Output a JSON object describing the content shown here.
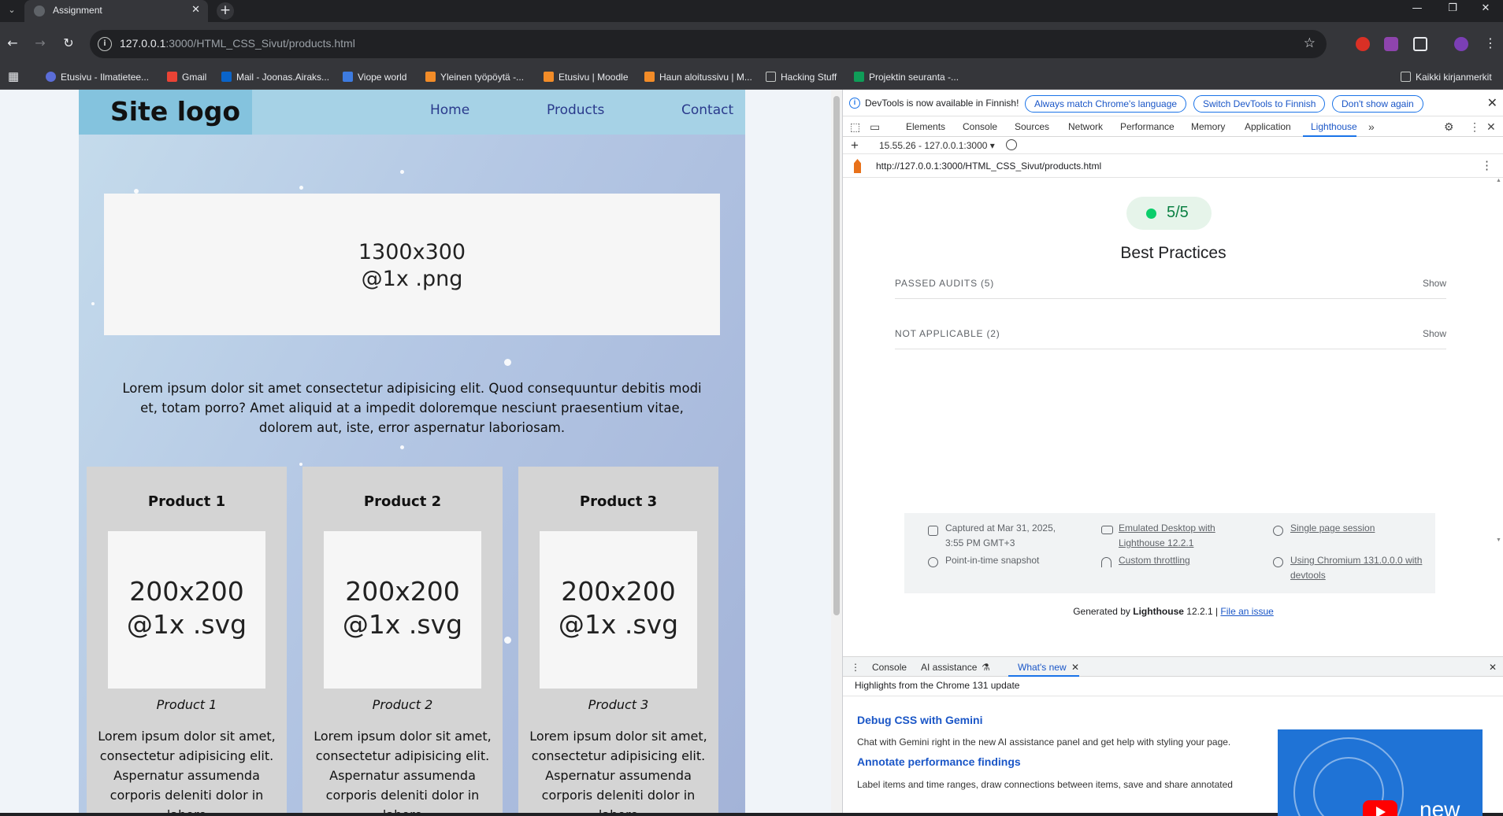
{
  "browser": {
    "tab_title": "Assignment",
    "tab_close": "✕",
    "new_tab": "+",
    "url_host": "127.0.0.1",
    "url_rest": ":3000/HTML_CSS_Sivut/products.html",
    "bookmarks": [
      "Etusivu - Ilmatietee...",
      "Gmail",
      "Mail - Joonas.Airaks...",
      "Viope world",
      "Yleinen työpöytä -...",
      "Etusivu | Moodle",
      "Haun aloitussivu | M...",
      "Hacking Stuff",
      "Projektin seuranta -..."
    ],
    "bookmarks_right": "Kaikki kirjanmerkit"
  },
  "site": {
    "logo": "Site logo",
    "nav": [
      "Home",
      "Products",
      "Contact"
    ],
    "hero_placeholder": "1300x300\n@1x .png",
    "intro": "Lorem ipsum dolor sit amet consectetur adipisicing elit. Quod consequuntur debitis modi et, totam porro? Amet aliquid at a impedit doloremque nesciunt praesentium vitae, dolorem aut, iste, error aspernatur laboriosam.",
    "products": [
      {
        "title": "Product 1",
        "image": "200x200\n@1x .svg",
        "caption": "Product 1",
        "desc": "Lorem ipsum dolor sit amet, consectetur adipisicing elit. Aspernatur assumenda corporis deleniti dolor in labore"
      },
      {
        "title": "Product 2",
        "image": "200x200\n@1x .svg",
        "caption": "Product 2",
        "desc": "Lorem ipsum dolor sit amet, consectetur adipisicing elit. Aspernatur assumenda corporis deleniti dolor in labore"
      },
      {
        "title": "Product 3",
        "image": "200x200\n@1x .svg",
        "caption": "Product 3",
        "desc": "Lorem ipsum dolor sit amet, consectetur adipisicing elit. Aspernatur assumenda corporis deleniti dolor in labore"
      }
    ]
  },
  "devtools": {
    "infobar": {
      "text": "DevTools is now available in Finnish!",
      "buttons": [
        "Always match Chrome's language",
        "Switch DevTools to Finnish",
        "Don't show again"
      ]
    },
    "tabs": [
      "Elements",
      "Console",
      "Sources",
      "Network",
      "Performance",
      "Memory",
      "Application",
      "Lighthouse"
    ],
    "active_tab": "Lighthouse",
    "report_select": "15.55.26 - 127.0.0.1:3000",
    "report_url": "http://127.0.0.1:3000/HTML_CSS_Sivut/products.html",
    "score": "5/5",
    "category": "Best Practices",
    "audits": [
      {
        "label": "PASSED AUDITS",
        "count": "(5)",
        "action": "Show"
      },
      {
        "label": "NOT APPLICABLE",
        "count": "(2)",
        "action": "Show"
      }
    ],
    "meta": {
      "captured": "Captured at Mar 31, 2025, 3:55 PM GMT+3",
      "snapshot": "Point-in-time snapshot",
      "emulated": "Emulated Desktop with Lighthouse 12.2.1",
      "throttling": "Custom throttling",
      "session": "Single page session",
      "chromium": "Using Chromium 131.0.0.0 with devtools"
    },
    "generated_prefix": "Generated by ",
    "generated_brand": "Lighthouse",
    "generated_version": " 12.2.1 | ",
    "file_issue": "File an issue",
    "drawer": {
      "tabs": [
        "Console",
        "AI assistance",
        "What's new"
      ],
      "active_tab": "What's new",
      "highlights": "Highlights from the Chrome 131 update",
      "items": [
        {
          "title": "Debug CSS with Gemini",
          "text": "Chat with Gemini right in the new AI assistance panel and get help with styling your page."
        },
        {
          "title": "Annotate performance findings",
          "text": "Label items and time ranges, draw connections between items, save and share annotated"
        }
      ],
      "video_text": "new"
    }
  },
  "colors": {
    "accent": "#1a73e8",
    "score_green": "#0cce6b",
    "site_header": "#a6d2e6",
    "card_bg": "#d4d4d4"
  }
}
